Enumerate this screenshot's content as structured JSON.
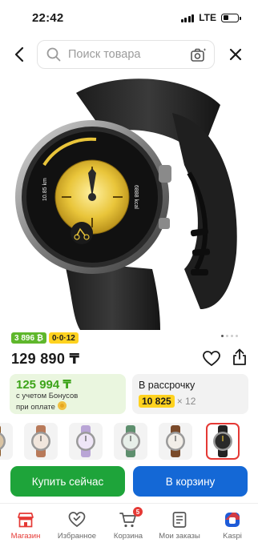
{
  "status_bar": {
    "time": "22:42",
    "network": "LTE"
  },
  "search": {
    "placeholder": "Поиск товара"
  },
  "product": {
    "badge_bonus": "3 896 ₿",
    "badge_plan": "0·0·12",
    "price": "129 890 ₸",
    "bonus_card": {
      "price": "125 994 ₸",
      "note_line1": "с учетом Бонусов",
      "note_line2": "при оплате"
    },
    "credit_card": {
      "title": "В рассрочку",
      "amount": "10 825",
      "multiplier": "× 12"
    },
    "image_dial": {
      "left_text": "10.85 km",
      "right_text": "6888 kcal"
    }
  },
  "variants": [
    {
      "name": "brown-strap",
      "band": "#8b5a2b",
      "face": "#d9c3a3"
    },
    {
      "name": "rose-leather",
      "band": "#b87a5a",
      "face": "#f1e6dd"
    },
    {
      "name": "lilac",
      "band": "#b9a5d6",
      "face": "#efe6f7"
    },
    {
      "name": "green",
      "band": "#5e8f6e",
      "face": "#e7efe9"
    },
    {
      "name": "brown-leather",
      "band": "#7a4a2a",
      "face": "#f2eee8"
    },
    {
      "name": "black",
      "band": "#222222",
      "face": "#2a2a2a"
    }
  ],
  "actions": {
    "buy_now": "Купить сейчас",
    "to_cart": "В корзину"
  },
  "nav": [
    {
      "label": "Магазин",
      "icon": "shop-icon",
      "active": true
    },
    {
      "label": "Избранное",
      "icon": "heart-check-icon",
      "active": false
    },
    {
      "label": "Корзина",
      "icon": "cart-icon",
      "active": false,
      "badge": "5"
    },
    {
      "label": "Мои заказы",
      "icon": "orders-icon",
      "active": false
    },
    {
      "label": "Kaspi",
      "icon": "kaspi-logo-icon",
      "active": false
    }
  ],
  "colors": {
    "accent_red": "#e53935",
    "buy_green": "#1ea43a",
    "cart_blue": "#1468d6",
    "bonus_green": "#3da41a",
    "yellow": "#ffd21f"
  }
}
